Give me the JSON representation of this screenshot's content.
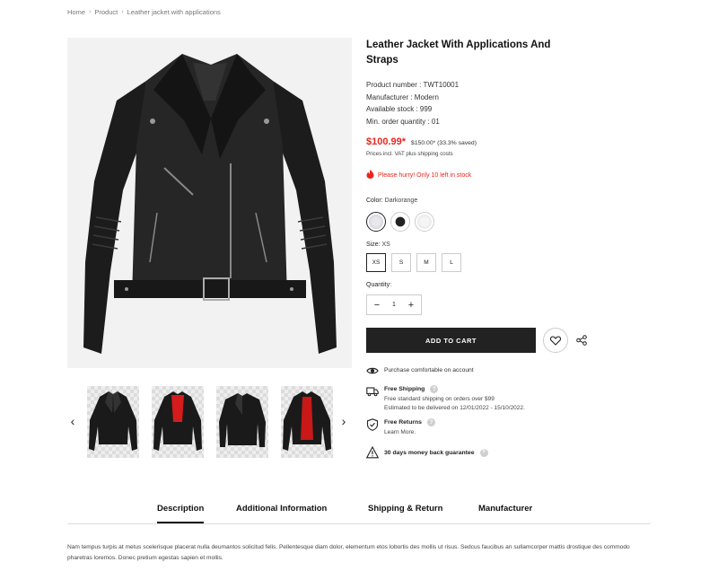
{
  "breadcrumb": {
    "items": [
      "Home",
      "Product",
      "Leather jacket with applications"
    ],
    "separator": "›"
  },
  "product": {
    "title": "Leather Jacket With Applications And Straps",
    "meta": [
      "Product number : TWT10001",
      "Manufacturer : Modern",
      "Available stock : 999",
      "Min. order quantity : 01"
    ],
    "price": "$100.99*",
    "old_price": "$150.00* (33.3% saved)",
    "tax_note": "Prices incl. VAT plus shipping costs",
    "hurry": "Please hurry! Only 10 left in stock"
  },
  "options": {
    "color_label": "Color:",
    "color_value": "Darkorange",
    "swatches": [
      "light-jacket",
      "black-jacket",
      "white-jacket"
    ],
    "size_label": "Size:",
    "size_value": "XS",
    "sizes": [
      "XS",
      "S",
      "M",
      "L"
    ],
    "quantity_label": "Quantity:",
    "quantity": "1",
    "minus": "−",
    "plus": "+"
  },
  "actions": {
    "add_to_cart": "ADD TO CART"
  },
  "features": {
    "purchase": "Purchase comfortable on account",
    "shipping_title": "Free Shipping",
    "shipping_line1": "Free standard shipping on orders over $99",
    "shipping_line2": "Estimated to be delivered on 12/01/2022 - 15/10/2022.",
    "returns_title": "Free Returns",
    "returns_line": "Learn More.",
    "guarantee_title": "30 days money back guarantee",
    "help": "?"
  },
  "thumbnails": {
    "prev": "‹",
    "next": "›",
    "items": [
      "jacket-black",
      "jacket-red-lining",
      "jacket-black-flat",
      "jacket-red-open"
    ]
  },
  "tabs": [
    "Description",
    "Additional Information",
    "Shipping & Return",
    "Manufacturer"
  ],
  "description": "Nam tempus turpis at metus scelerisque placerat nulla deumantos solicitud felis. Pellentesque diam dolor, elementum etos lobortis des mollis ut risus. Sedcus faucibus an sullamcorper mattis drostique des commodo pharetras loremos. Donec pretium egestas sapien et mollis.",
  "colors": {
    "accent": "#e8261f",
    "button": "#222222",
    "image_bg": "#f2f2f2"
  }
}
